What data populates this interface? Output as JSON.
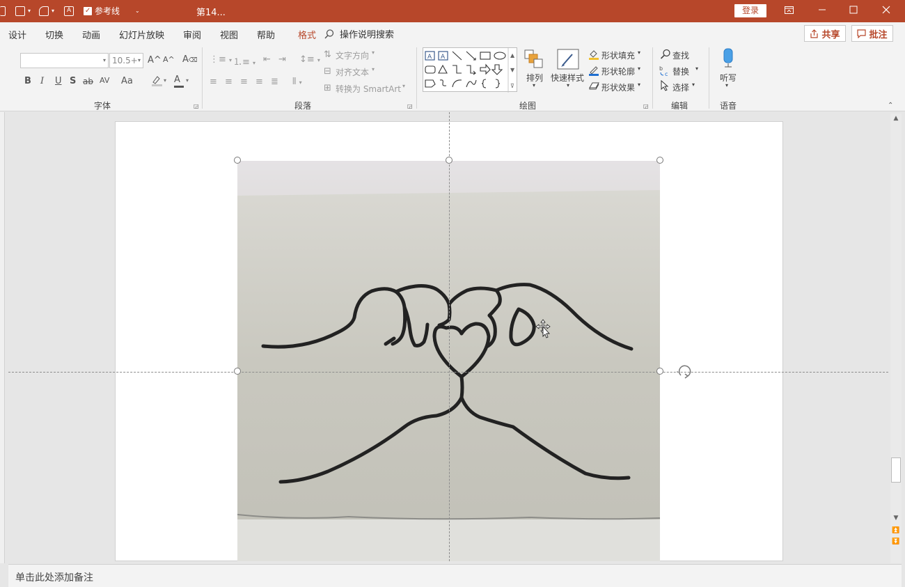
{
  "titlebar": {
    "guides_label": "参考线",
    "doc_title": "第14...",
    "login_label": "登录",
    "colors": {
      "accent": "#b7472a",
      "ribbon_bg": "#f3f3f3"
    }
  },
  "tabs": [
    {
      "label": "设计"
    },
    {
      "label": "切换"
    },
    {
      "label": "动画"
    },
    {
      "label": "幻灯片放映"
    },
    {
      "label": "审阅"
    },
    {
      "label": "视图"
    },
    {
      "label": "帮助"
    },
    {
      "label": "格式"
    }
  ],
  "search": {
    "label": "操作说明搜索",
    "icon": "search-icon"
  },
  "share_label": "共享",
  "comment_label": "批注",
  "ribbon": {
    "font": {
      "size_value": "10.5+",
      "group_label": "字体",
      "bold": "B",
      "italic": "I",
      "underline": "U",
      "shadow": "S",
      "strike": "ab",
      "spacing": "AV",
      "case": "Aa",
      "grow": "A^",
      "shrink": "A^",
      "color": "A"
    },
    "paragraph": {
      "text_direction": "文字方向",
      "align_text": "对齐文本",
      "smartart": "转换为 SmartArt",
      "group_label": "段落"
    },
    "drawing": {
      "arrange": "排列",
      "quick_styles": "快速样式",
      "shape_fill": "形状填充",
      "shape_outline": "形状轮廓",
      "shape_effects": "形状效果",
      "group_label": "绘图"
    },
    "editing": {
      "find": "查找",
      "replace": "替换",
      "select": "选择",
      "group_label": "编辑"
    },
    "voice": {
      "dictate": "听写",
      "group_label": "语音"
    }
  },
  "notes": {
    "placeholder": "单击此处添加备注"
  }
}
